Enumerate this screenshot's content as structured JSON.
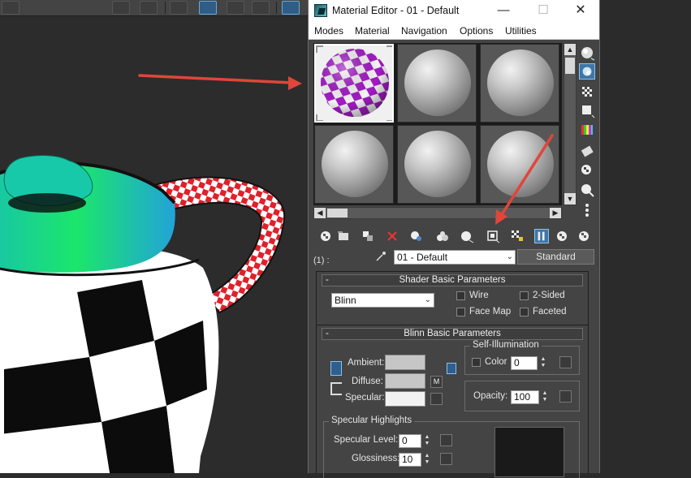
{
  "window": {
    "title": "Material Editor - 01 - Default",
    "minimize_glyph": "—",
    "maximize_glyph": "☐",
    "close_glyph": "✕"
  },
  "menu": [
    "Modes",
    "Material",
    "Navigation",
    "Options",
    "Utilities"
  ],
  "sample_slots": [
    {
      "material": "checker purple-white",
      "active": true
    },
    {
      "material": "default gray",
      "active": false
    },
    {
      "material": "default gray",
      "active": false
    },
    {
      "material": "default gray",
      "active": false
    },
    {
      "material": "default gray",
      "active": false
    },
    {
      "material": "default gray",
      "active": false
    }
  ],
  "scroll": {
    "up": "▲",
    "down": "▼",
    "left": "◀",
    "right": "▶"
  },
  "material_row": {
    "slot_index": "(1) :",
    "name": "01 - Default",
    "type_button": "Standard",
    "dropdown_arrow": "⌄"
  },
  "shader_rollout": {
    "title": "Shader Basic Parameters",
    "collapse": "-",
    "shader": "Blinn",
    "wire": "Wire",
    "two_sided": "2-Sided",
    "face_map": "Face Map",
    "faceted": "Faceted"
  },
  "blinn_rollout": {
    "title": "Blinn Basic Parameters",
    "collapse": "-",
    "ambient": "Ambient:",
    "diffuse": "Diffuse:",
    "specular": "Specular:",
    "diffuse_map_button": "M",
    "self_illum_group": "Self-Illumination",
    "color_label": "Color",
    "self_illum_value": "0",
    "opacity_label": "Opacity:",
    "opacity_value": "100",
    "specular_group": "Specular Highlights",
    "spec_level_label": "Specular Level:",
    "spec_level_value": "0",
    "glossiness_label": "Glossiness:",
    "glossiness_value": "10"
  },
  "colors": {
    "ambient_swatch": "#c6c6c6",
    "diffuse_swatch": "#c6c6c6",
    "specular_swatch": "#f2f2f2",
    "highlight_preview": "#1a1a1a",
    "annotation_arrow": "#e0463a",
    "accent": "#3f76a8"
  },
  "icons": {
    "app": "3dsmax-material-editor-icon",
    "side_tools": [
      "sample-type-sphere-icon",
      "backlight-icon",
      "background-checker-icon",
      "sample-uv-tiling-icon",
      "video-color-check-icon",
      "make-preview-icon",
      "options-icon",
      "select-by-material-icon",
      "material-map-navigator-icon"
    ],
    "toolbar": [
      "get-material-icon",
      "put-to-scene-icon",
      "assign-to-selection-icon",
      "reset-map-icon",
      "make-unique-icon",
      "put-to-library-icon",
      "material-id-channel-icon",
      "show-shaded-material-icon",
      "show-end-result-icon",
      "go-to-parent-icon",
      "go-forward-to-sibling-icon"
    ]
  }
}
